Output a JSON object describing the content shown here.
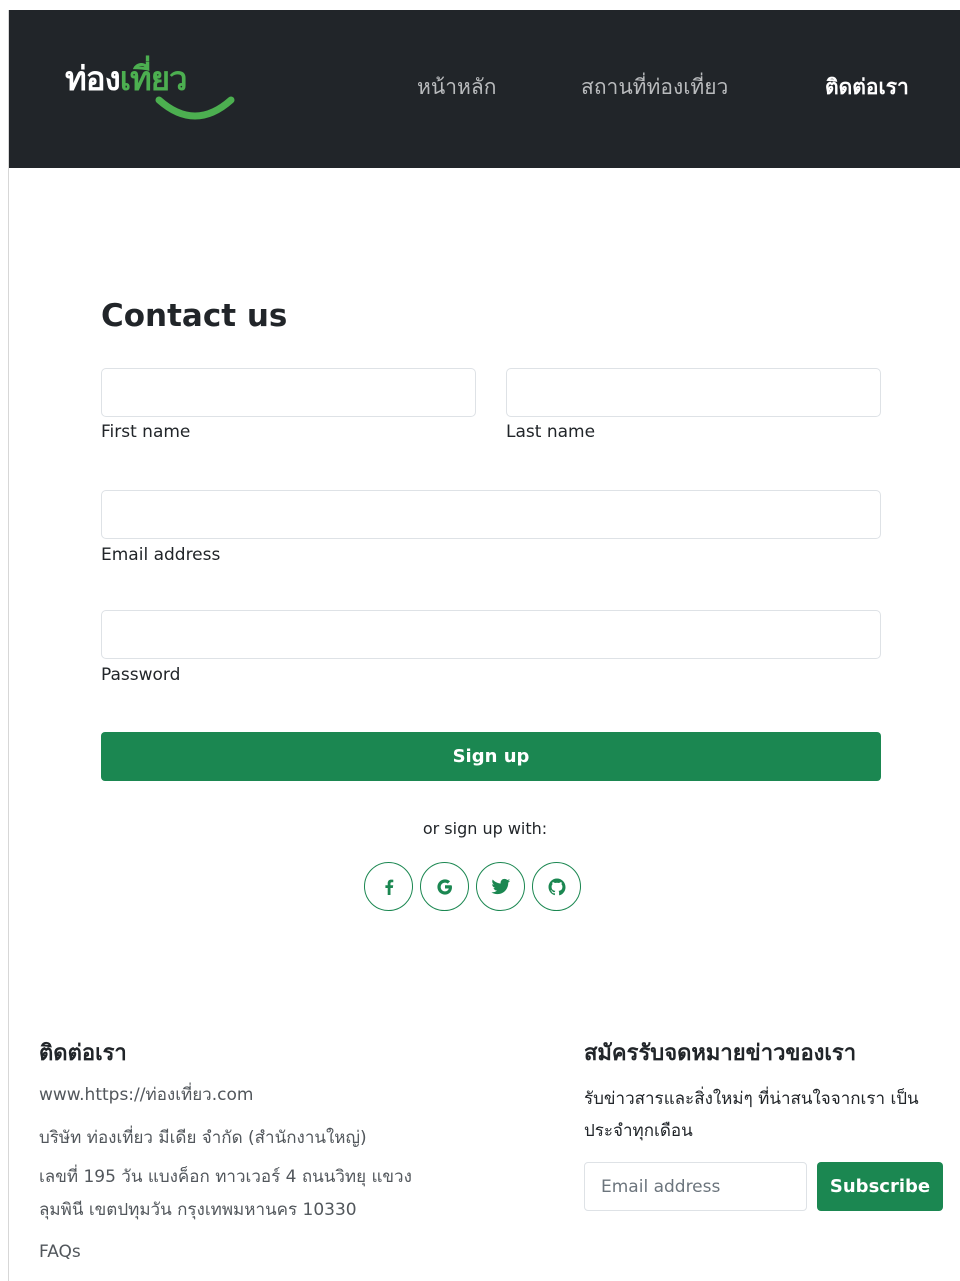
{
  "navbar": {
    "brand_dark": "ท่อง",
    "brand_green": "เที่ยว",
    "links": [
      {
        "label": "หน้าหลัก",
        "active": false
      },
      {
        "label": "สถานที่ท่องเที่ยว",
        "active": false
      },
      {
        "label": "ติดต่อเรา",
        "active": true
      }
    ]
  },
  "form": {
    "title": "Contact us",
    "first_name_label": "First name",
    "last_name_label": "Last name",
    "email_label": "Email address",
    "password_label": "Password",
    "first_name_value": "",
    "last_name_value": "",
    "email_value": "",
    "password_value": "",
    "submit_label": "Sign up",
    "social_prompt": "or sign up with:",
    "socials": [
      "facebook-icon",
      "google-icon",
      "twitter-icon",
      "github-icon"
    ]
  },
  "footer": {
    "contact": {
      "heading": "ติดต่อเรา",
      "website": "www.https://ท่องเที่ยว.com",
      "company": "บริษัท ท่องเที่ยว มีเดีย จำกัด (สำนักงานใหญ่)",
      "address_line1": "เลขที่ 195 วัน แบงค็อก ทาวเวอร์ 4 ถนนวิทยุ แขวง",
      "address_line2": "ลุมพินี เขตปทุมวัน กรุงเทพมหานคร 10330",
      "faq": "FAQs"
    },
    "newsletter": {
      "heading": "สมัครรับจดหมายข่าวของเรา",
      "description": "รับข่าวสารและสิ่งใหม่ๆ ที่น่าสนใจจากเรา เป็นประจำทุกเดือน",
      "email_placeholder": "Email address",
      "subscribe_label": "Subscribe"
    }
  },
  "colors": {
    "navbar_bg": "#212529",
    "brand_green": "#4caf50",
    "primary": "#1b8751"
  }
}
